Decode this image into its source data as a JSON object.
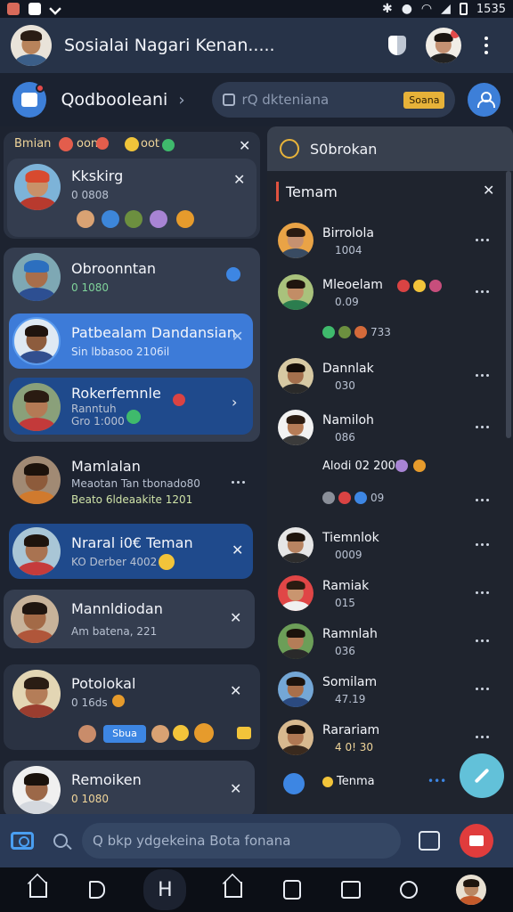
{
  "status_bar": {
    "time": "1535"
  },
  "header": {
    "title": "Sosialai Nagari Kenan....."
  },
  "subheader": {
    "title": "Qodbooleani",
    "search_placeholder": "rQ dkteniana",
    "search_tag": "Soana"
  },
  "left_panel": {
    "tag_strip": {
      "label": "Bmian",
      "chip1": "oon",
      "chip2": "oot"
    },
    "items": [
      {
        "name": "Kkskirg",
        "sub": "0 0808"
      },
      {
        "name": "Obroonntan",
        "sub": "0 1080"
      },
      {
        "name": "Patbealam Dandansian",
        "sub": "Sin lbbasoo 2106il"
      },
      {
        "name": "Rokerfemnle",
        "sub": "Ranntuh",
        "sub2": "Gro 1:000"
      },
      {
        "name": "Mamlalan",
        "sub": "Meaotan Tan tbonado80",
        "sub2": "Beato 6ldeaakite 1201"
      },
      {
        "name": "Nraral i0€ Teman",
        "sub": "KO Derber 4002"
      },
      {
        "name": "Mannldiodan",
        "sub": "Am batena, 221"
      },
      {
        "name": "Potolokal",
        "sub": "0 16ds",
        "badge": "Sbua"
      },
      {
        "name": "Remoiken",
        "sub": "0 1080"
      }
    ]
  },
  "right_panel": {
    "header_title": "S0brokan",
    "tab_label": "Temam",
    "items": [
      {
        "name": "Birrolola",
        "sub": "1004"
      },
      {
        "name": "Mleoelam",
        "sub": "0.09"
      },
      {
        "extra": "733"
      },
      {
        "name": "Dannlak",
        "sub": "030"
      },
      {
        "name": "Namiloh",
        "sub": "086"
      },
      {
        "extra": "Alodi 02 2009"
      },
      {
        "extra": "09"
      },
      {
        "name": "Tiemnlok",
        "sub": "0009"
      },
      {
        "name": "Ramiak",
        "sub": "015"
      },
      {
        "name": "Ramnlah",
        "sub": "036"
      },
      {
        "name": "Somilam",
        "sub": "47.19"
      },
      {
        "name": "Rarariam",
        "sub": "4 0! 30"
      },
      {
        "name": "Tenma"
      }
    ]
  },
  "compose": {
    "placeholder": "Q bkp ydgekeina Bota fonana"
  },
  "icons": [
    "photo-icon",
    "wifi-icon",
    "battery-icon",
    "shield-icon",
    "camera-icon",
    "search-icon",
    "edit-icon",
    "video-icon",
    "home-icon"
  ],
  "colors": {
    "accent": "#3d7bd8",
    "header": "#273348",
    "danger": "#e03c3c",
    "fab": "#62c1d9"
  }
}
